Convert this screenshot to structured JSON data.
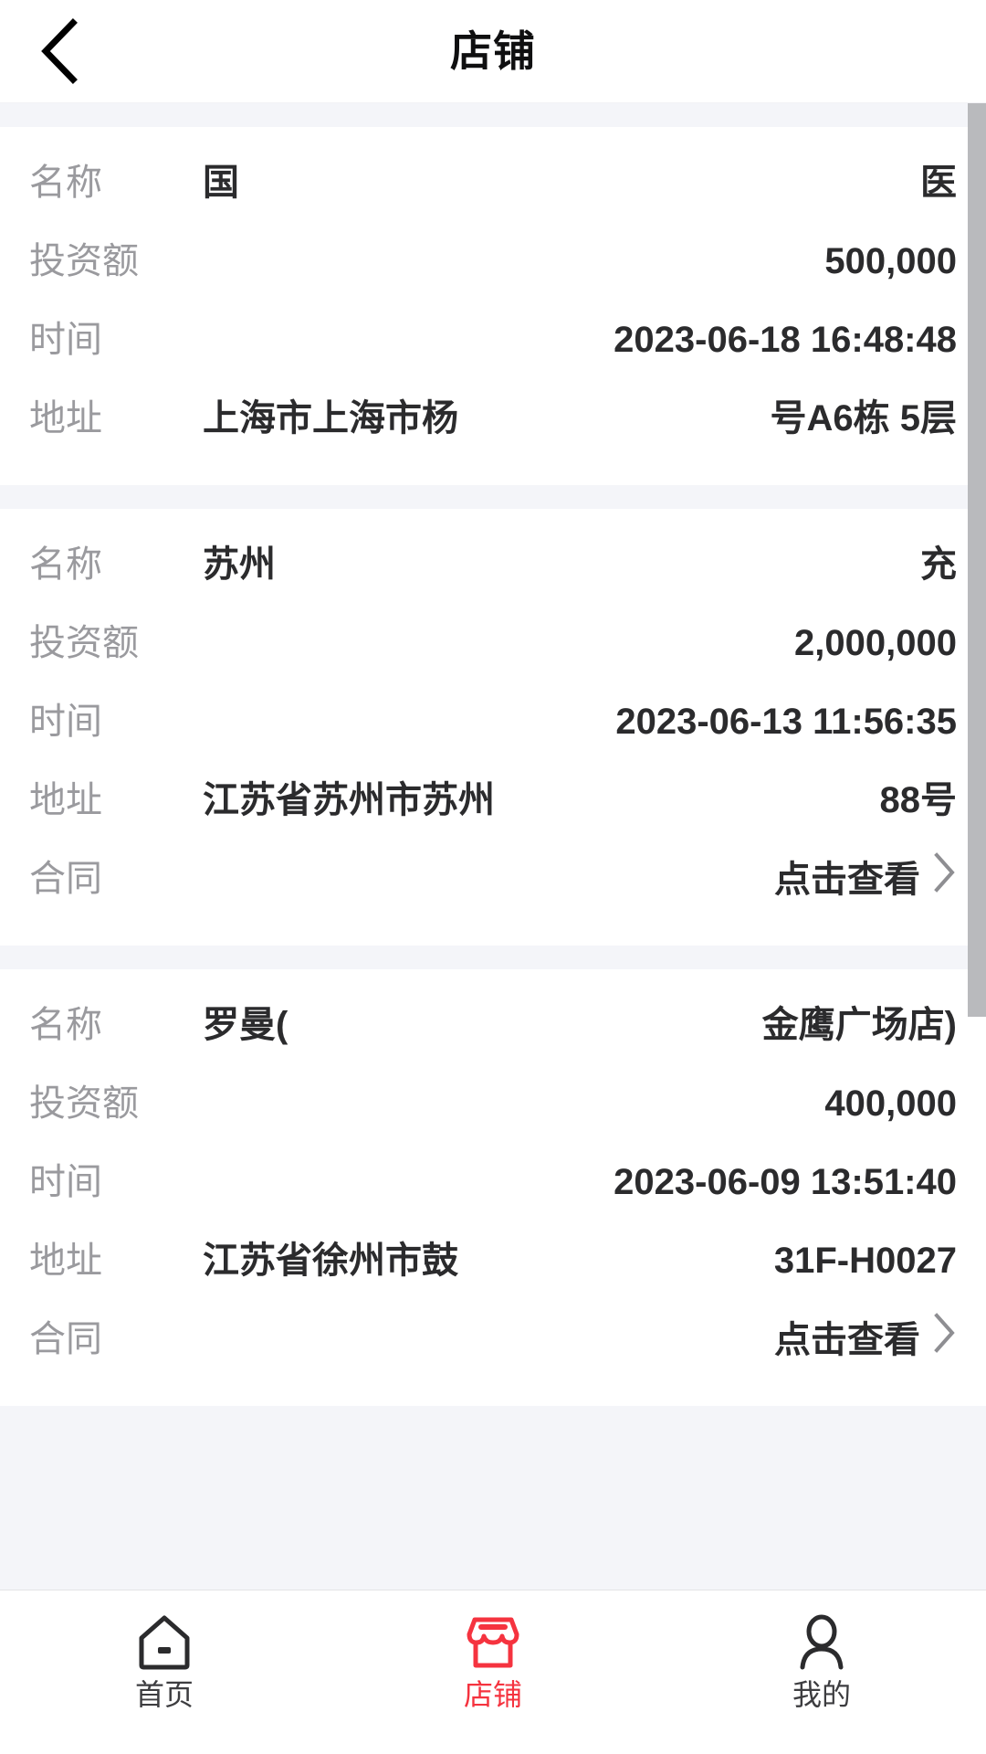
{
  "header": {
    "title": "店铺",
    "back_icon": "chevron-left-icon"
  },
  "labels": {
    "name": "名称",
    "investment": "投资额",
    "time": "时间",
    "address": "地址",
    "contract": "合同"
  },
  "cards": [
    {
      "name_left": "国",
      "name_right": "医",
      "investment": "500,000",
      "time": "2023-06-18 16:48:48",
      "address_left": "上海市上海市杨",
      "address_right": "号A6栋 5层",
      "contract": null,
      "contract_action": null
    },
    {
      "name_left": "苏州",
      "name_right": "充",
      "investment": "2,000,000",
      "time": "2023-06-13 11:56:35",
      "address_left": "江苏省苏州市苏州",
      "address_right": "88号",
      "contract": "合同",
      "contract_action": "点击查看"
    },
    {
      "name_left": "罗曼(",
      "name_right": "金鹰广场店)",
      "investment": "400,000",
      "time": "2023-06-09 13:51:40",
      "address_left": "江苏省徐州市鼓",
      "address_right": "31F-H0027",
      "contract": "合同",
      "contract_action": "点击查看"
    }
  ],
  "tabbar": {
    "items": [
      {
        "label": "首页",
        "icon": "home-icon",
        "active": false
      },
      {
        "label": "店铺",
        "icon": "store-icon",
        "active": true
      },
      {
        "label": "我的",
        "icon": "profile-icon",
        "active": false
      }
    ]
  },
  "colors": {
    "accent": "#f5333f",
    "label_text": "#9a9a9e",
    "value_text": "#2b2b2d",
    "page_bg": "#f4f5f9",
    "card_bg": "#ffffff",
    "scrollbar": "#b9babd"
  }
}
